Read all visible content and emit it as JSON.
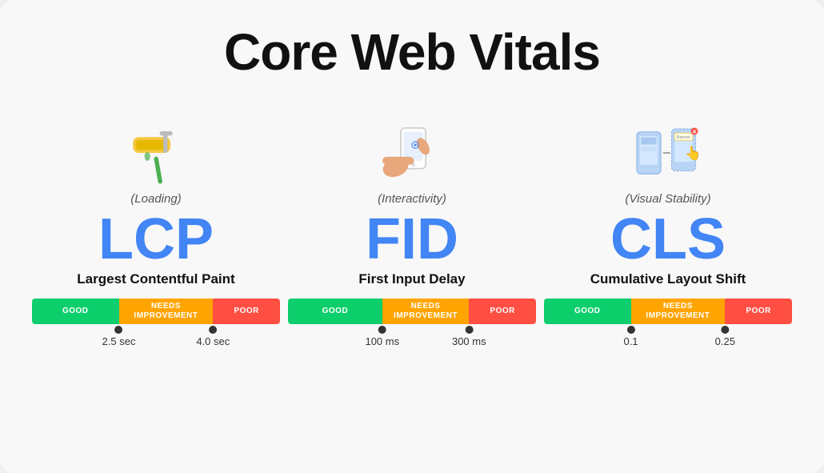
{
  "title": "Core Web Vitals",
  "metrics": [
    {
      "id": "lcp",
      "subtitle": "(Loading)",
      "acronym": "LCP",
      "fullname": "Largest Contentful Paint",
      "bar": {
        "good_label": "GOOD",
        "needs_label": "NEEDS\nIMPROVEMENT",
        "poor_label": "POOR",
        "good_pct": 35,
        "needs_pct": 38,
        "poor_pct": 27
      },
      "markers": [
        {
          "value": "2.5 sec",
          "pct": 35
        },
        {
          "value": "4.0 sec",
          "pct": 73
        }
      ]
    },
    {
      "id": "fid",
      "subtitle": "(Interactivity)",
      "acronym": "FID",
      "fullname": "First Input Delay",
      "bar": {
        "good_label": "GOOD",
        "needs_label": "NEEDS\nIMPROVEMENT",
        "poor_label": "POOR",
        "good_pct": 38,
        "needs_pct": 35,
        "poor_pct": 27
      },
      "markers": [
        {
          "value": "100 ms",
          "pct": 38
        },
        {
          "value": "300 ms",
          "pct": 73
        }
      ]
    },
    {
      "id": "cls",
      "subtitle": "(Visual Stability)",
      "acronym": "CLS",
      "fullname": "Cumulative Layout Shift",
      "bar": {
        "good_label": "GOOD",
        "needs_label": "NEEDS\nIMPROVEMENT",
        "poor_label": "POOR",
        "good_pct": 35,
        "needs_pct": 38,
        "poor_pct": 27
      },
      "markers": [
        {
          "value": "0.1",
          "pct": 35
        },
        {
          "value": "0.25",
          "pct": 73
        }
      ]
    }
  ]
}
